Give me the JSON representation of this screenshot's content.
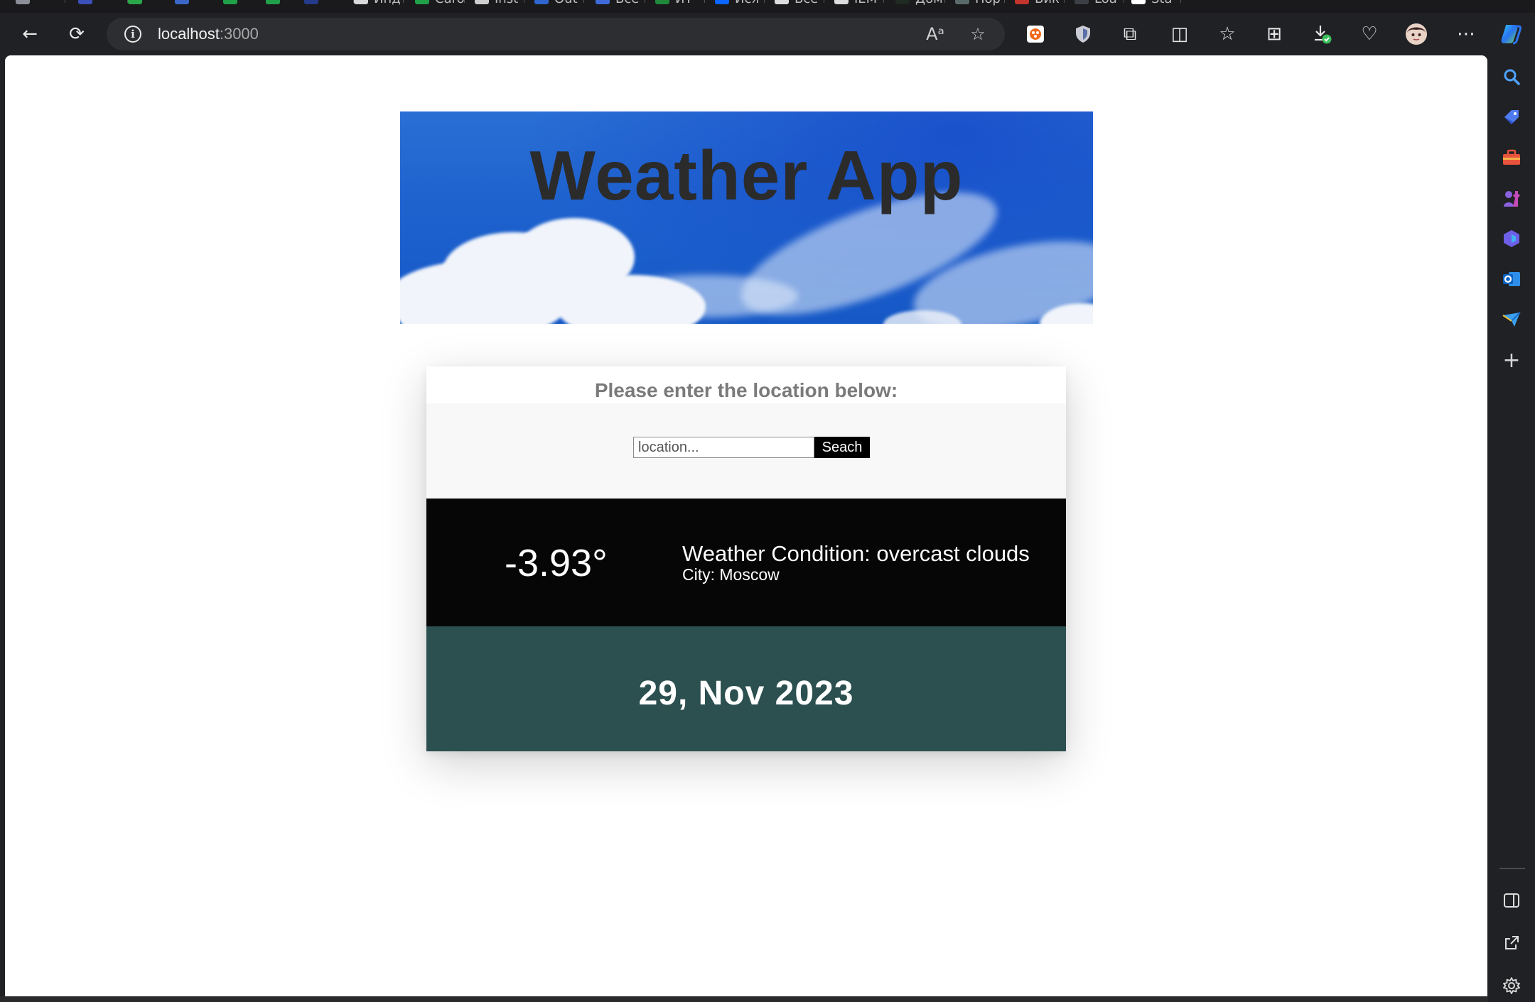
{
  "browser": {
    "tabs": [
      {
        "label": "",
        "color": "#8d8f98"
      },
      {
        "label": "",
        "color": "#3a4fb8"
      },
      {
        "label": "",
        "color": "#2aa84a"
      },
      {
        "label": "",
        "color": "#3b67c9"
      },
      {
        "label": "",
        "color": "#21a04a"
      },
      {
        "label": "",
        "color": "#21a04a"
      },
      {
        "label": "",
        "color": "#243a8a"
      },
      {
        "label": "Инд",
        "color": "#d9d9d9"
      },
      {
        "label": "Caro",
        "color": "#21a04a"
      },
      {
        "label": "Inst",
        "color": "#cfcfcf"
      },
      {
        "label": "Out",
        "color": "#2f66d0"
      },
      {
        "label": "Все",
        "color": "#3f6ad8"
      },
      {
        "label": "ИТ",
        "color": "#1f8a3a"
      },
      {
        "label": "Ися",
        "color": "#0a66ff"
      },
      {
        "label": "Все",
        "color": "#dddddd"
      },
      {
        "label": "IEM",
        "color": "#dddddd"
      },
      {
        "label": "Дом",
        "color": "#1e2a22"
      },
      {
        "label": "Нор",
        "color": "#5a6a6a"
      },
      {
        "label": "Вик",
        "color": "#c2342c"
      },
      {
        "label": "Loa",
        "color": "#3c3f45"
      },
      {
        "label": "Sta",
        "color": "#ffffff"
      }
    ],
    "address": {
      "host": "localhost",
      "port": ":3000"
    },
    "nav": {
      "back_icon": "←",
      "reload_icon": "⟳"
    },
    "toolbar_icons": {
      "read_aloud": "Aᵃ",
      "favorite": "☆",
      "extensions": "⧉",
      "split": "◫",
      "favorites": "☆",
      "collections": "⊞",
      "downloads": "⤓",
      "health": "♡",
      "more": "⋯"
    }
  },
  "app": {
    "title": "Weather App",
    "prompt": "Please enter the location below:",
    "search": {
      "placeholder": "location...",
      "button_label": "Seach"
    },
    "weather": {
      "temperature": "-3.93°",
      "condition": "Weather Condition: overcast clouds",
      "city": "City: Moscow"
    },
    "date": "29, Nov 2023"
  }
}
